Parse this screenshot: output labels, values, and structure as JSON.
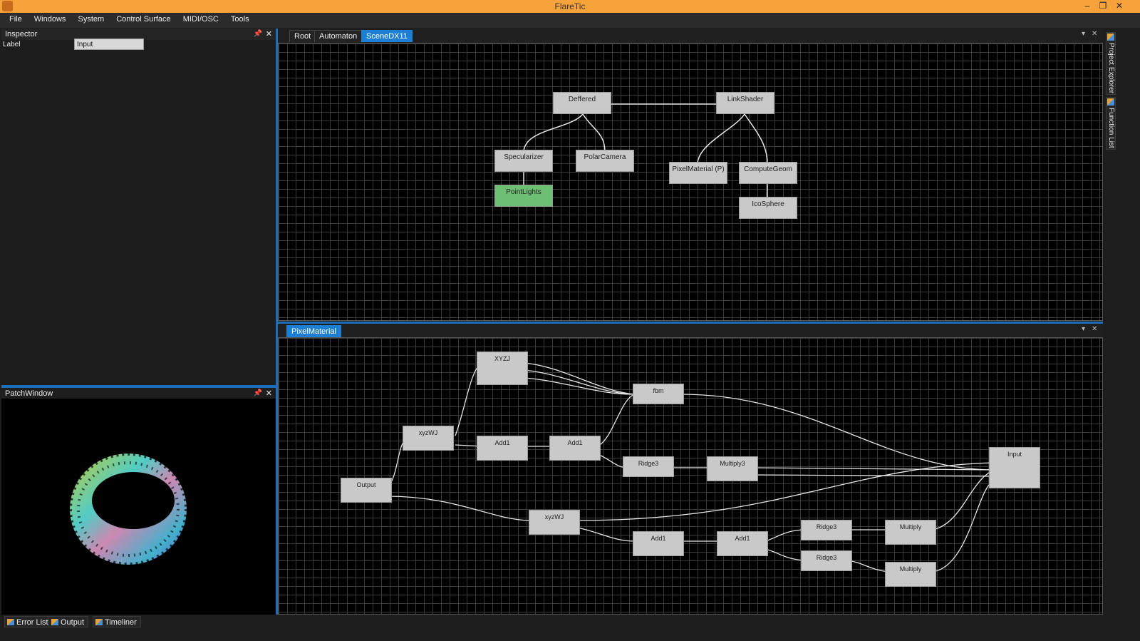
{
  "window": {
    "title": "FlareTic",
    "min_icon": "minimize-icon",
    "restore_icon": "restore-icon",
    "close_icon": "close-icon"
  },
  "menu": [
    "File",
    "Windows",
    "System",
    "Control Surface",
    "MIDI/OSC",
    "Tools"
  ],
  "inspector": {
    "title": "Inspector",
    "label_key": "Label",
    "label_value": "Input"
  },
  "patchwindow": {
    "title": "PatchWindow"
  },
  "bottom_tabs": [
    "Error List",
    "Output",
    "Timeliner"
  ],
  "right_sidebar": [
    "Project Explorer",
    "Function List"
  ],
  "scene_editor": {
    "tabs": [
      "Root",
      "Automaton",
      "SceneDX11"
    ],
    "active_tab": "SceneDX11",
    "nodes": [
      "Deffered",
      "LinkShader",
      "Specularizer",
      "PolarCamera",
      "PointLights",
      "PixelMaterial (P)",
      "ComputeGeom",
      "IcoSphere"
    ]
  },
  "pixel_editor": {
    "tabs": [
      "PixelMaterial"
    ],
    "nodes": [
      "XYZJ",
      "fbm",
      "xyzWJ",
      "Add1",
      "Add1",
      "Ridge3",
      "Multiply3",
      "Input",
      "Output",
      "xyzWJ",
      "Add1",
      "Add1",
      "Ridge3",
      "Multiply",
      "Ridge3",
      "Multiply"
    ]
  },
  "colors": {
    "accent": "#1d7fd4",
    "titlebar": "#f7a23a",
    "node": "#c9c9c9",
    "node_selected": "#6dbf73"
  }
}
